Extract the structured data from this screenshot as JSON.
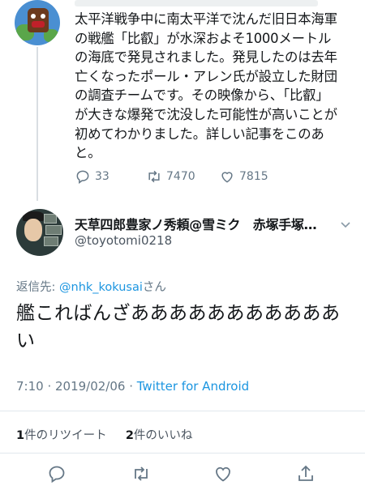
{
  "parent_tweet": {
    "text": "太平洋戦争中に南太平洋で沈んだ旧日本海軍\nの戦艦「比叡」が水深およそ1000メートル\nの海底で発見されました。発見したのは去年\n亡くなったポール・アレン氏が設立した財団\nの調査チームです。その映像から、「比叡」\nが大きな爆発で沈没した可能性が高いことが\n初めてわかりました。詳しい記事をこのあ\nと。",
    "reply_count": "33",
    "retweet_count": "7470",
    "like_count": "7815"
  },
  "reply_tweet": {
    "display_name": "天草四郎豊家ノ秀頼@雪ミク　赤塚手塚…",
    "handle": "@toyotomi0218",
    "reply_to_label": "返信先: ",
    "reply_to_mention": "@nhk_kokusai",
    "reply_to_suffix": "さん",
    "text": "艦こればんざあああああああああああ\nい",
    "time": "7:10 · 2019/02/06 · ",
    "client": "Twitter for Android",
    "retweets": "1",
    "retweets_label": "件のリツイート",
    "likes": "2",
    "likes_label": "件のいいね"
  },
  "icons": [
    "reply-icon",
    "retweet-icon",
    "like-icon",
    "share-icon",
    "chevron-down-icon"
  ],
  "colors": {
    "accent": "#1b95e0",
    "muted": "#657786",
    "text": "#14171a"
  }
}
